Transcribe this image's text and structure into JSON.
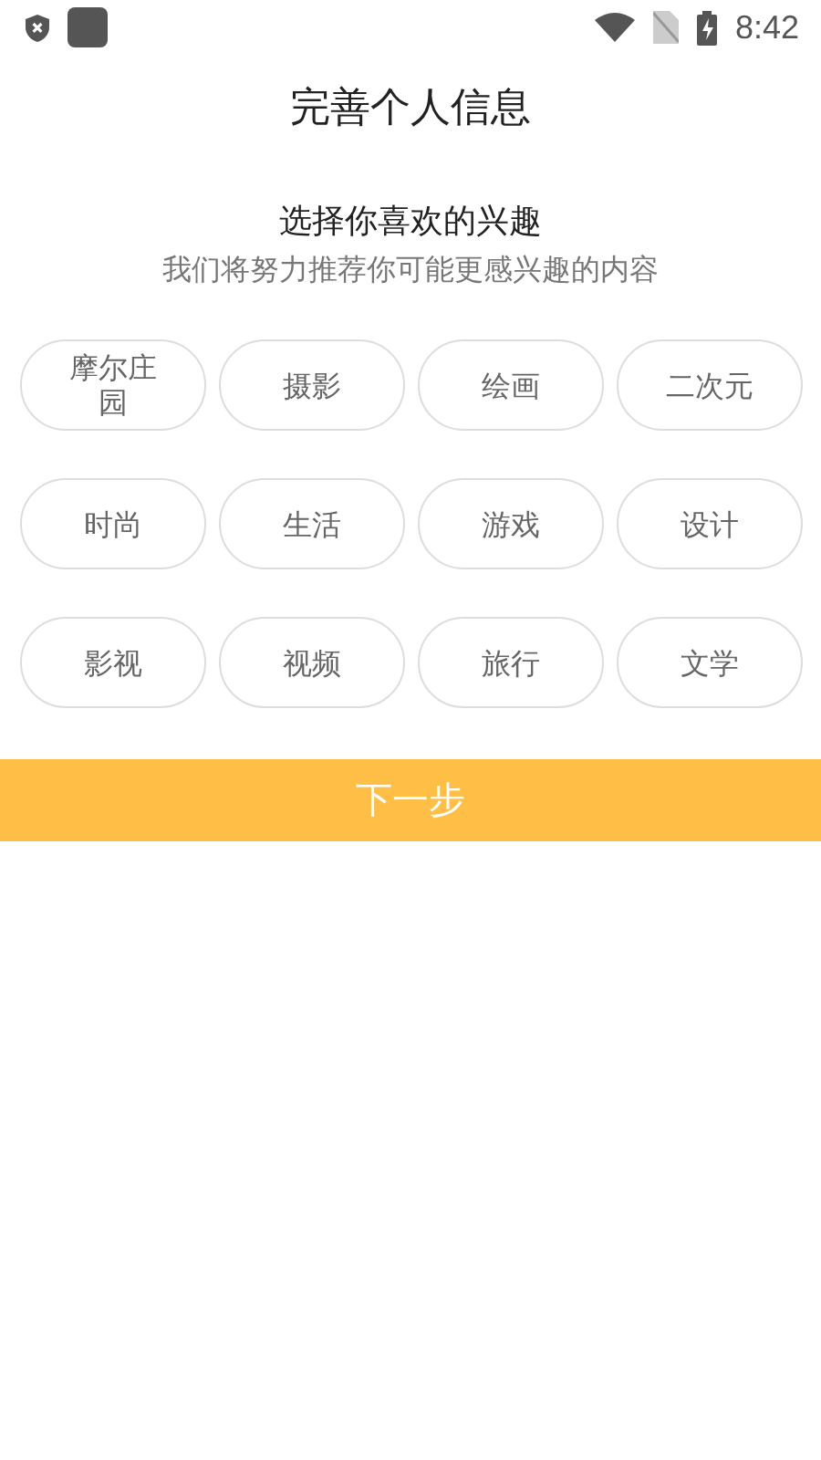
{
  "status_bar": {
    "time": "8:42"
  },
  "title": "完善个人信息",
  "heading": "选择你喜欢的兴趣",
  "subheading": "我们将努力推荐你可能更感兴趣的内容",
  "interests": [
    {
      "label": "摩尔庄园",
      "selected": false
    },
    {
      "label": "摄影",
      "selected": false
    },
    {
      "label": "绘画",
      "selected": false
    },
    {
      "label": "二次元",
      "selected": false
    },
    {
      "label": "时尚",
      "selected": false
    },
    {
      "label": "生活",
      "selected": false
    },
    {
      "label": "游戏",
      "selected": false
    },
    {
      "label": "设计",
      "selected": false
    },
    {
      "label": "影视",
      "selected": false
    },
    {
      "label": "视频",
      "selected": false
    },
    {
      "label": "旅行",
      "selected": false
    },
    {
      "label": "文学",
      "selected": false
    }
  ],
  "next_button": "下一步"
}
